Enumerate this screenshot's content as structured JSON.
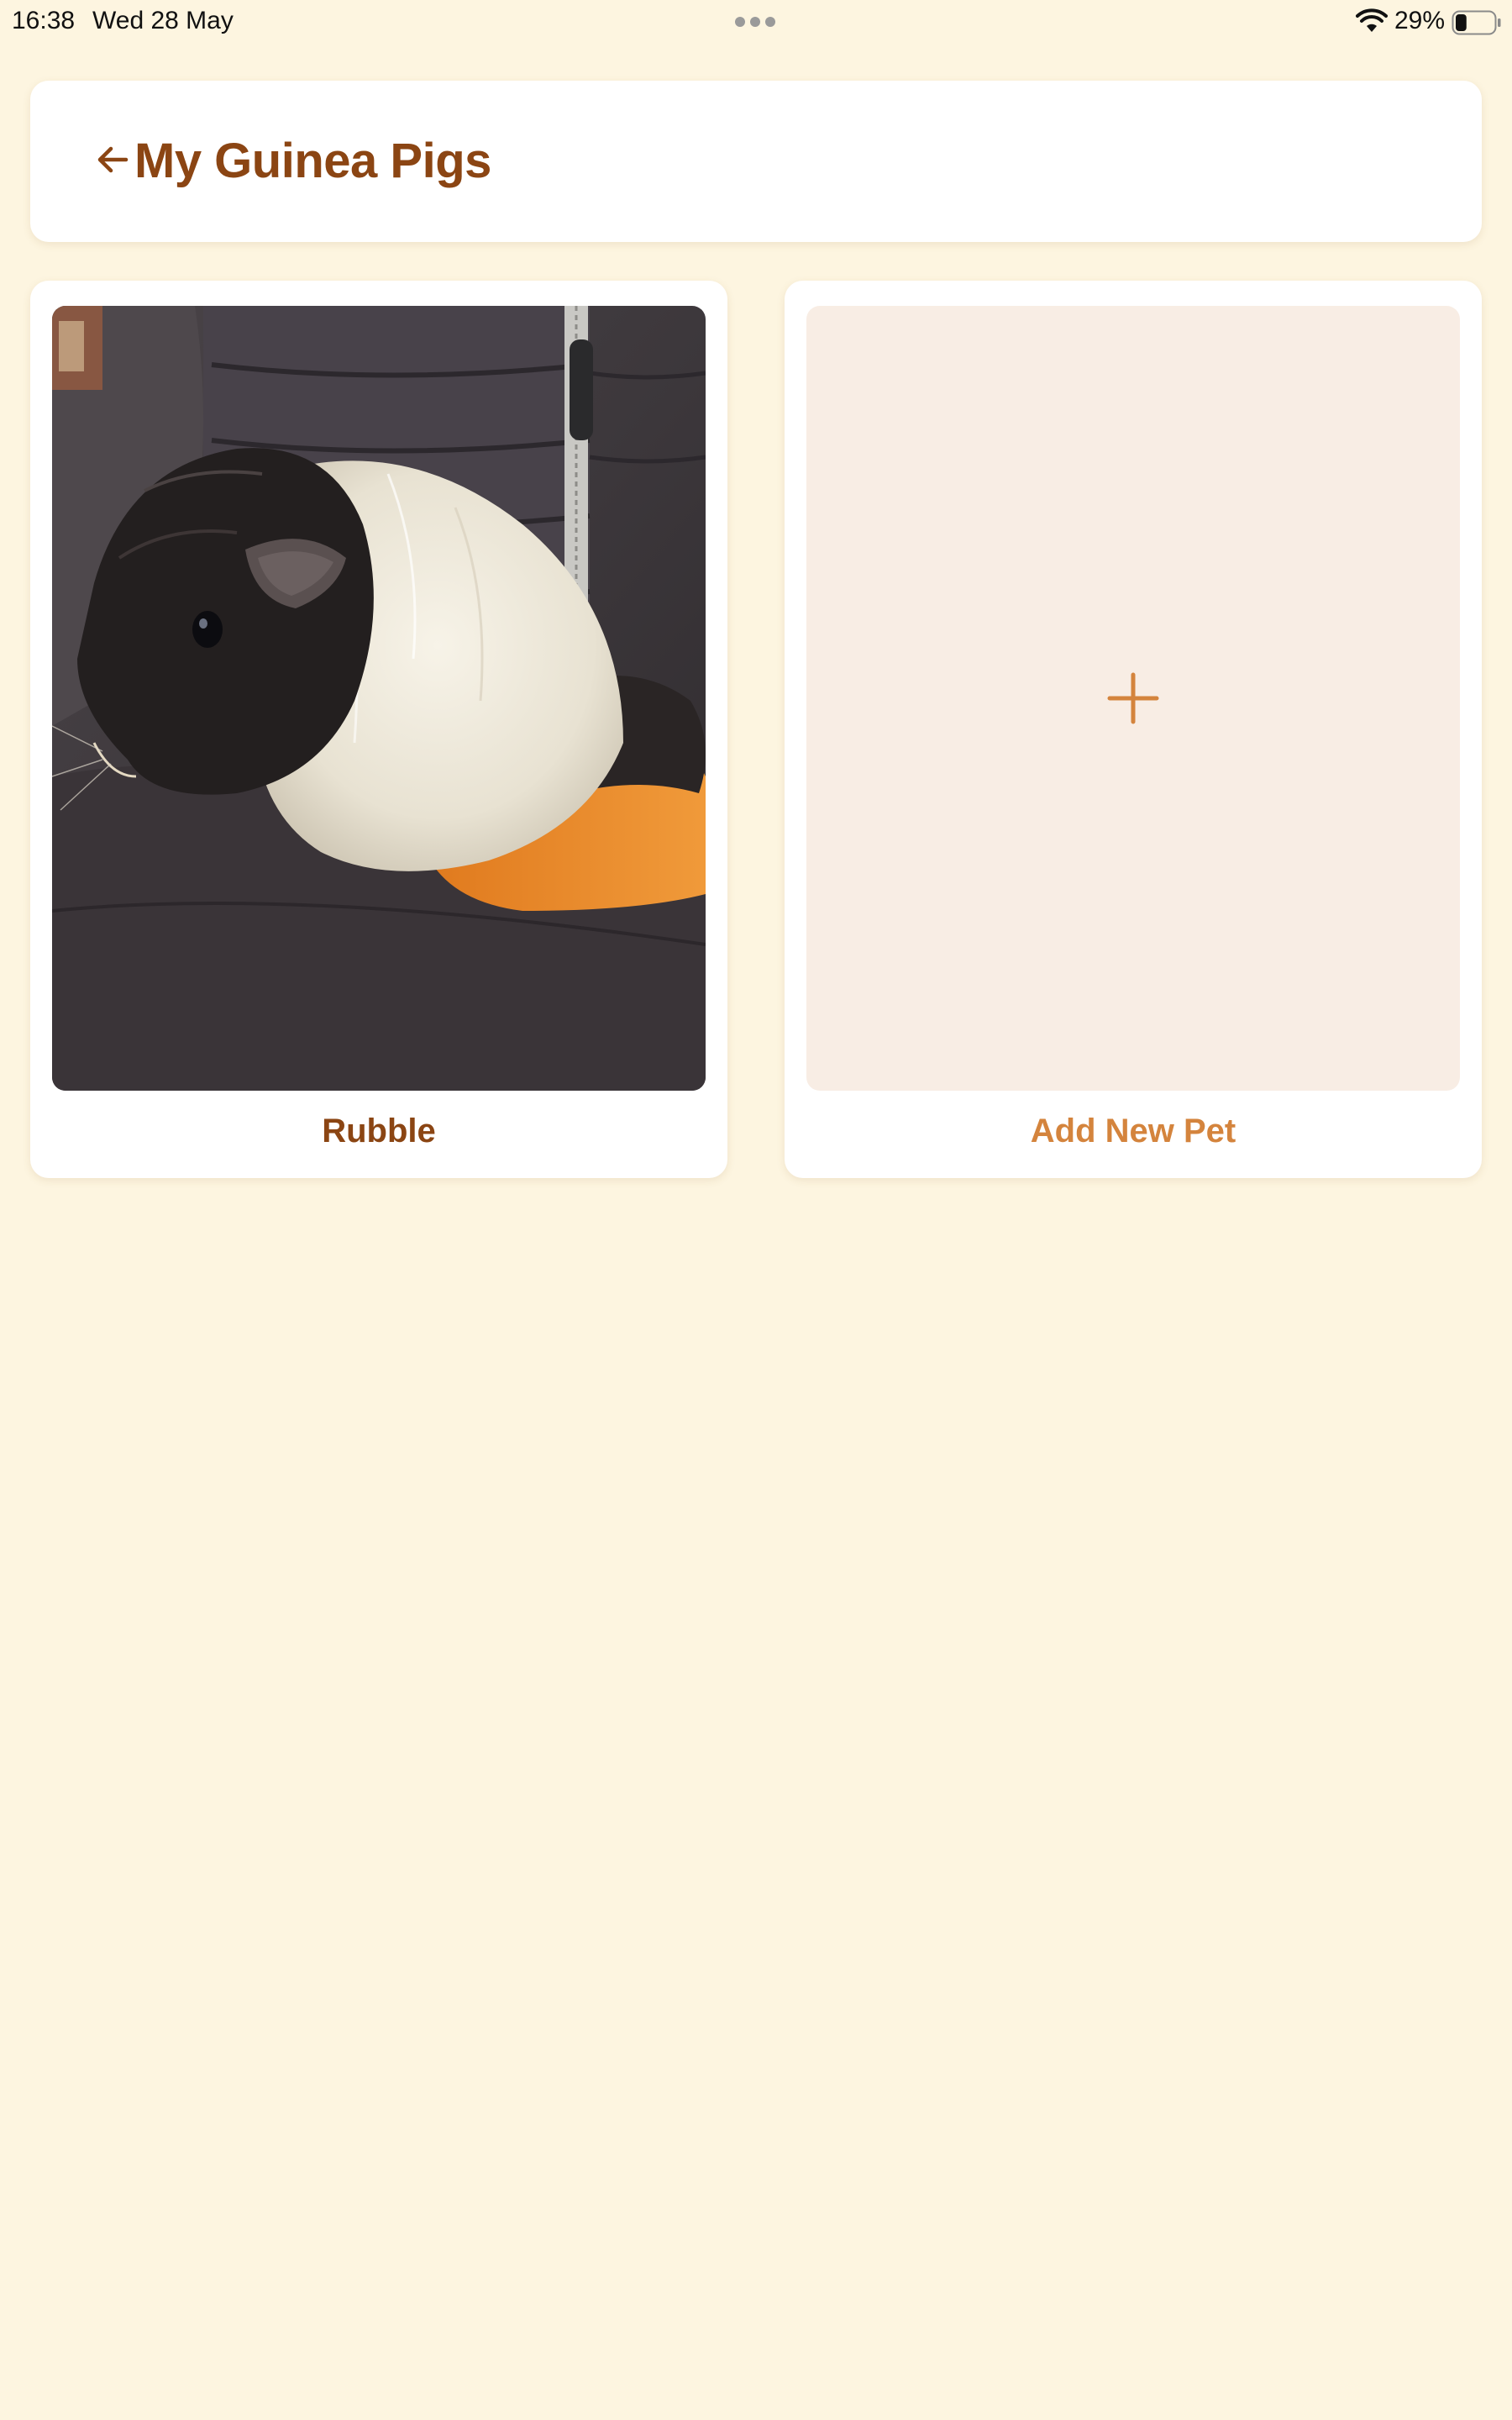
{
  "status_bar": {
    "time": "16:38",
    "date": "Wed 28 May",
    "battery_percent": "29%",
    "battery_level": 0.29,
    "wifi_icon": "wifi-icon",
    "battery_icon": "battery-icon"
  },
  "header": {
    "title": "My Guinea Pigs",
    "back_icon": "arrow-left-icon"
  },
  "pets": [
    {
      "name": "Rubble",
      "photo": "guinea-pig-photo"
    }
  ],
  "add_pet": {
    "label": "Add New Pet",
    "icon": "plus-icon"
  },
  "colors": {
    "background": "#fdf5e0",
    "title_brown": "#8b4513",
    "accent_orange": "#d4843d",
    "add_tile_bg": "#f8ede4",
    "card_bg": "#ffffff"
  }
}
